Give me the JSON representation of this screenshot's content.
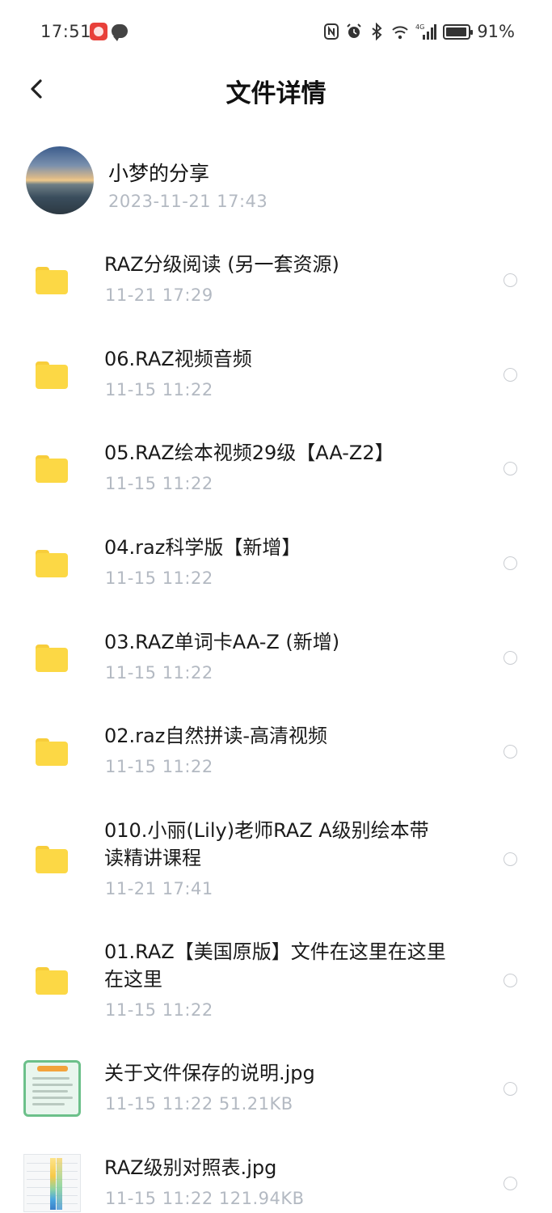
{
  "status_bar": {
    "time": "17:51",
    "battery": "91%",
    "network": "4G",
    "icons": [
      "red-app-icon",
      "message-icon",
      "nfc-icon",
      "alarm-icon",
      "bluetooth-icon",
      "wifi-icon",
      "signal-icon",
      "battery-icon"
    ]
  },
  "header": {
    "title": "文件详情",
    "back_icon": "chevron-left-icon"
  },
  "share": {
    "name": "小梦的分享",
    "time": "2023-11-21  17:43"
  },
  "files": [
    {
      "name": "RAZ分级阅读 (另一套资源)",
      "meta": "11-21  17:29",
      "icon": "folder-icon"
    },
    {
      "name": "06.RAZ视频音频",
      "meta": "11-15  11:22",
      "icon": "folder-icon"
    },
    {
      "name": "05.RAZ绘本视频29级【AA-Z2】",
      "meta": "11-15  11:22",
      "icon": "folder-icon"
    },
    {
      "name": "04.raz科学版【新增】",
      "meta": "11-15  11:22",
      "icon": "folder-icon"
    },
    {
      "name": "03.RAZ单词卡AA-Z (新增)",
      "meta": "11-15  11:22",
      "icon": "folder-icon"
    },
    {
      "name": "02.raz自然拼读-高清视频",
      "meta": "11-15  11:22",
      "icon": "folder-icon"
    },
    {
      "name": "010.小丽(Lily)老师RAZ A级别绘本带读精讲课程",
      "meta": "11-21  17:41",
      "icon": "folder-icon"
    },
    {
      "name": "01.RAZ【美国原版】文件在这里在这里在这里",
      "meta": "11-15  11:22",
      "icon": "folder-icon"
    },
    {
      "name": "关于文件保存的说明.jpg",
      "meta": "11-15  11:22  51.21KB",
      "icon": "image-thumbnail-icon"
    },
    {
      "name": "RAZ级别对照表.jpg",
      "meta": "11-15  11:22  121.94KB",
      "icon": "image-thumbnail-icon"
    }
  ],
  "colors": {
    "folder": "#fcd845",
    "meta_text": "#b3b9c2",
    "primary_text": "#1a1a1a",
    "thumb_border": "#6cc08a"
  }
}
